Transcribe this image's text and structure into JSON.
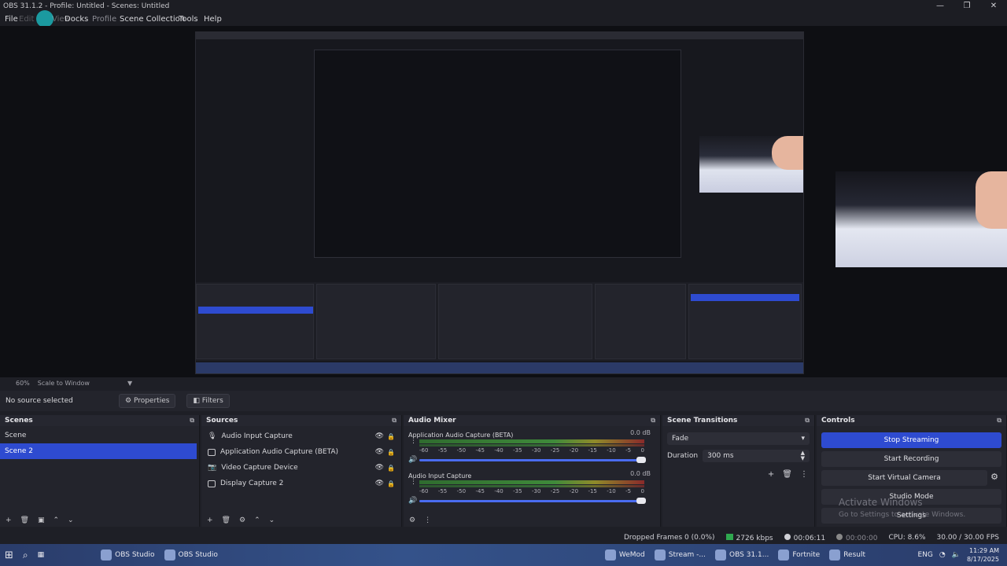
{
  "window": {
    "title": "OBS 31.1.2 - Profile: Untitled - Scenes: Untitled",
    "controls": [
      "—",
      "❐",
      "✕"
    ]
  },
  "menu": {
    "items": [
      "File",
      "Edit",
      "View",
      "Docks",
      "Profile",
      "Scene Collection",
      "Tools",
      "Help"
    ]
  },
  "preview": {
    "zoom": "60%",
    "scale_mode": "Scale to Window"
  },
  "properties_bar": {
    "no_source": "No source selected",
    "properties_label": "Properties",
    "filters_label": "Filters"
  },
  "scenes": {
    "title": "Scenes",
    "items": [
      {
        "label": "Scene",
        "selected": false
      },
      {
        "label": "Scene 2",
        "selected": true
      }
    ]
  },
  "sources": {
    "title": "Sources",
    "items": [
      {
        "label": "Audio Input Capture",
        "icon": "mic-icon"
      },
      {
        "label": "Application Audio Capture (BETA)",
        "icon": "app-icon"
      },
      {
        "label": "Video Capture Device",
        "icon": "camera-icon"
      },
      {
        "label": "Display Capture 2",
        "icon": "monitor-icon"
      }
    ]
  },
  "mixer": {
    "title": "Audio Mixer",
    "channels": [
      {
        "name": "Application Audio Capture (BETA)",
        "db": "0.0 dB"
      },
      {
        "name": "Audio Input Capture",
        "db": "0.0 dB"
      }
    ],
    "ticks": [
      "-60",
      "-55",
      "-50",
      "-45",
      "-40",
      "-35",
      "-30",
      "-25",
      "-20",
      "-15",
      "-10",
      "-5",
      "0"
    ]
  },
  "transitions": {
    "title": "Scene Transitions",
    "selected": "Fade",
    "duration_label": "Duration",
    "duration_value": "300 ms"
  },
  "controls": {
    "title": "Controls",
    "stop_streaming": "Stop Streaming",
    "start_recording": "Start Recording",
    "start_virtual_camera": "Start Virtual Camera",
    "studio_mode": "Studio Mode",
    "settings": "Settings"
  },
  "watermark": {
    "line1": "Activate Windows",
    "line2": "Go to Settings to activate Windows."
  },
  "status": {
    "dropped_frames": "Dropped Frames 0 (0.0%)",
    "bitrate": "2726 kbps",
    "stream_time": "00:06:11",
    "rec_time": "00:00:00",
    "cpu": "CPU: 8.6%",
    "fps": "30.00 / 30.00 FPS"
  },
  "taskbar": {
    "apps": [
      "OBS Studio",
      "OBS Studio",
      "WeMod",
      "Stream -...",
      "OBS 31.1...",
      "Fortnite",
      "Result"
    ],
    "language": "ENG",
    "time": "11:29 AM",
    "date": "8/17/2025"
  },
  "colors": {
    "accent": "#2e4bd0",
    "panel": "#23242c",
    "background": "#1e1f26"
  }
}
